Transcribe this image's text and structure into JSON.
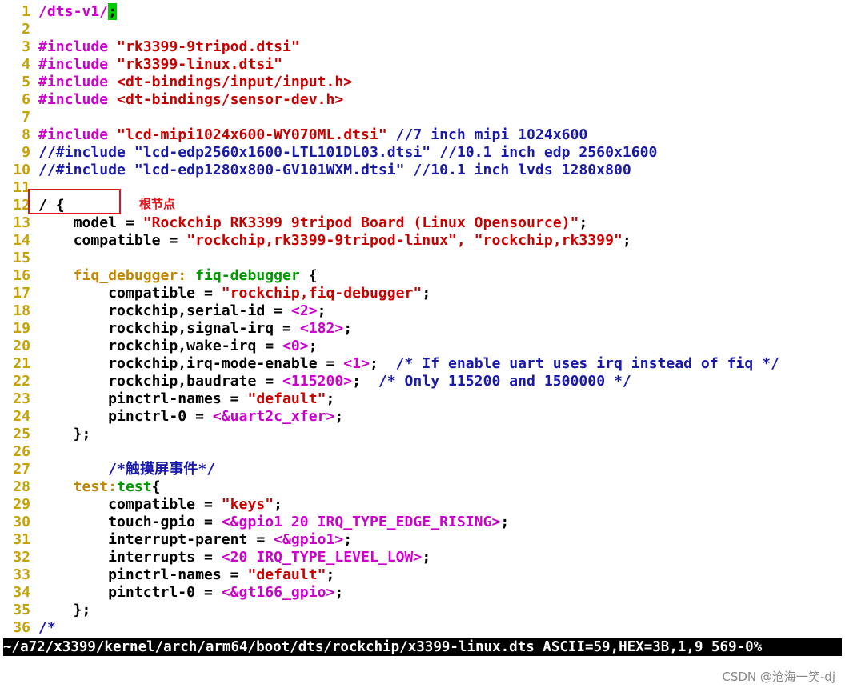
{
  "lines": [
    {
      "n": "1",
      "segs": [
        {
          "t": "/dts-v1/",
          "c": "mag"
        },
        {
          "t": ";",
          "c": "cursor"
        }
      ]
    },
    {
      "n": "2",
      "segs": []
    },
    {
      "n": "3",
      "segs": [
        {
          "t": "#include ",
          "c": "mag"
        },
        {
          "t": "\"rk3399-9tripod.dtsi\"",
          "c": "red"
        }
      ]
    },
    {
      "n": "4",
      "segs": [
        {
          "t": "#include ",
          "c": "mag"
        },
        {
          "t": "\"rk3399-linux.dtsi\"",
          "c": "red"
        }
      ]
    },
    {
      "n": "5",
      "segs": [
        {
          "t": "#include ",
          "c": "mag"
        },
        {
          "t": "<dt-bindings/input/input.h>",
          "c": "red"
        }
      ]
    },
    {
      "n": "6",
      "segs": [
        {
          "t": "#include ",
          "c": "mag"
        },
        {
          "t": "<dt-bindings/sensor-dev.h>",
          "c": "red"
        }
      ]
    },
    {
      "n": "7",
      "segs": []
    },
    {
      "n": "8",
      "segs": [
        {
          "t": "#include ",
          "c": "mag"
        },
        {
          "t": "\"lcd-mipi1024x600-WY070ML.dtsi\"",
          "c": "red"
        },
        {
          "t": " //7 inch mipi 1024x600",
          "c": "blu"
        }
      ]
    },
    {
      "n": "9",
      "segs": [
        {
          "t": "//#include \"lcd-edp2560x1600-LTL101DL03.dtsi\" //10.1 inch edp 2560x1600",
          "c": "blu"
        }
      ]
    },
    {
      "n": "10",
      "segs": [
        {
          "t": "//#include \"lcd-edp1280x800-GV101WXM.dtsi\" //10.1 inch lvds 1280x800",
          "c": "blu"
        }
      ]
    },
    {
      "n": "11",
      "segs": []
    },
    {
      "n": "12",
      "segs": [
        {
          "t": "/ {",
          "c": "blk"
        }
      ]
    },
    {
      "n": "13",
      "segs": [
        {
          "t": "    model = ",
          "c": "blk"
        },
        {
          "t": "\"Rockchip RK3399 9tripod Board (Linux Opensource)\"",
          "c": "red"
        },
        {
          "t": ";",
          "c": "blk"
        }
      ]
    },
    {
      "n": "14",
      "segs": [
        {
          "t": "    compatible = ",
          "c": "blk"
        },
        {
          "t": "\"rockchip,rk3399-9tripod-linux\", \"rockchip,rk3399\"",
          "c": "red"
        },
        {
          "t": ";",
          "c": "blk"
        }
      ]
    },
    {
      "n": "15",
      "segs": []
    },
    {
      "n": "16",
      "segs": [
        {
          "t": "    fiq_debugger: ",
          "c": "org"
        },
        {
          "t": "fiq-debugger",
          "c": "grn"
        },
        {
          "t": " {",
          "c": "blk"
        }
      ]
    },
    {
      "n": "17",
      "segs": [
        {
          "t": "        compatible = ",
          "c": "blk"
        },
        {
          "t": "\"rockchip,fiq-debugger\"",
          "c": "red"
        },
        {
          "t": ";",
          "c": "blk"
        }
      ]
    },
    {
      "n": "18",
      "segs": [
        {
          "t": "        rockchip,serial-id = ",
          "c": "blk"
        },
        {
          "t": "<2>",
          "c": "mag"
        },
        {
          "t": ";",
          "c": "blk"
        }
      ]
    },
    {
      "n": "19",
      "segs": [
        {
          "t": "        rockchip,signal-irq = ",
          "c": "blk"
        },
        {
          "t": "<182>",
          "c": "mag"
        },
        {
          "t": ";",
          "c": "blk"
        }
      ]
    },
    {
      "n": "20",
      "segs": [
        {
          "t": "        rockchip,wake-irq = ",
          "c": "blk"
        },
        {
          "t": "<0>",
          "c": "mag"
        },
        {
          "t": ";",
          "c": "blk"
        }
      ]
    },
    {
      "n": "21",
      "segs": [
        {
          "t": "        rockchip,irq-mode-enable = ",
          "c": "blk"
        },
        {
          "t": "<1>",
          "c": "mag"
        },
        {
          "t": ";  ",
          "c": "blk"
        },
        {
          "t": "/* If enable uart uses irq instead of fiq */",
          "c": "blu"
        }
      ]
    },
    {
      "n": "22",
      "segs": [
        {
          "t": "        rockchip,baudrate = ",
          "c": "blk"
        },
        {
          "t": "<115200>",
          "c": "mag"
        },
        {
          "t": ";  ",
          "c": "blk"
        },
        {
          "t": "/* Only 115200 and 1500000 */",
          "c": "blu"
        }
      ]
    },
    {
      "n": "23",
      "segs": [
        {
          "t": "        pinctrl-names = ",
          "c": "blk"
        },
        {
          "t": "\"default\"",
          "c": "red"
        },
        {
          "t": ";",
          "c": "blk"
        }
      ]
    },
    {
      "n": "24",
      "segs": [
        {
          "t": "        pinctrl-0 = ",
          "c": "blk"
        },
        {
          "t": "<&uart2c_xfer>",
          "c": "mag"
        },
        {
          "t": ";",
          "c": "blk"
        }
      ]
    },
    {
      "n": "25",
      "segs": [
        {
          "t": "    };",
          "c": "blk"
        }
      ]
    },
    {
      "n": "26",
      "segs": []
    },
    {
      "n": "27",
      "segs": [
        {
          "t": "        /*触摸屏事件*/",
          "c": "blu"
        }
      ]
    },
    {
      "n": "28",
      "segs": [
        {
          "t": "    test:",
          "c": "org"
        },
        {
          "t": "test",
          "c": "grn"
        },
        {
          "t": "{",
          "c": "blk"
        }
      ]
    },
    {
      "n": "29",
      "segs": [
        {
          "t": "        compatible = ",
          "c": "blk"
        },
        {
          "t": "\"keys\"",
          "c": "red"
        },
        {
          "t": ";",
          "c": "blk"
        }
      ]
    },
    {
      "n": "30",
      "segs": [
        {
          "t": "        touch-gpio = ",
          "c": "blk"
        },
        {
          "t": "<&gpio1 20 IRQ_TYPE_EDGE_RISING>",
          "c": "mag"
        },
        {
          "t": ";",
          "c": "blk"
        }
      ]
    },
    {
      "n": "31",
      "segs": [
        {
          "t": "        interrupt-parent = ",
          "c": "blk"
        },
        {
          "t": "<&gpio1>",
          "c": "mag"
        },
        {
          "t": ";",
          "c": "blk"
        }
      ]
    },
    {
      "n": "32",
      "segs": [
        {
          "t": "        interrupts = ",
          "c": "blk"
        },
        {
          "t": "<20 IRQ_TYPE_LEVEL_LOW>",
          "c": "mag"
        },
        {
          "t": ";",
          "c": "blk"
        }
      ]
    },
    {
      "n": "33",
      "segs": [
        {
          "t": "        pinctrl-names = ",
          "c": "blk"
        },
        {
          "t": "\"default\"",
          "c": "red"
        },
        {
          "t": ";",
          "c": "blk"
        }
      ]
    },
    {
      "n": "34",
      "segs": [
        {
          "t": "        pintctrl-0 = ",
          "c": "blk"
        },
        {
          "t": "<&gt166_gpio>",
          "c": "mag"
        },
        {
          "t": ";",
          "c": "blk"
        }
      ]
    },
    {
      "n": "35",
      "segs": [
        {
          "t": "    };",
          "c": "blk"
        }
      ]
    },
    {
      "n": "36",
      "segs": [
        {
          "t": "/*",
          "c": "blu"
        }
      ]
    }
  ],
  "status_line": "~/a72/x3399/kernel/arch/arm64/boot/dts/rockchip/x3399-linux.dts ASCII=59,HEX=3B,1,9 569-0%",
  "annotation": "根节点",
  "watermark": "CSDN @沧海一笑-dj",
  "colors": {
    "line_number": "#c8a200",
    "preprocessor": "#cc00cc",
    "string": "#c80000",
    "comment": "#1a1aa8",
    "label": "#c08800",
    "node_name": "#009900",
    "cursor": "#00cc00",
    "annotation_box": "#e0161e"
  }
}
